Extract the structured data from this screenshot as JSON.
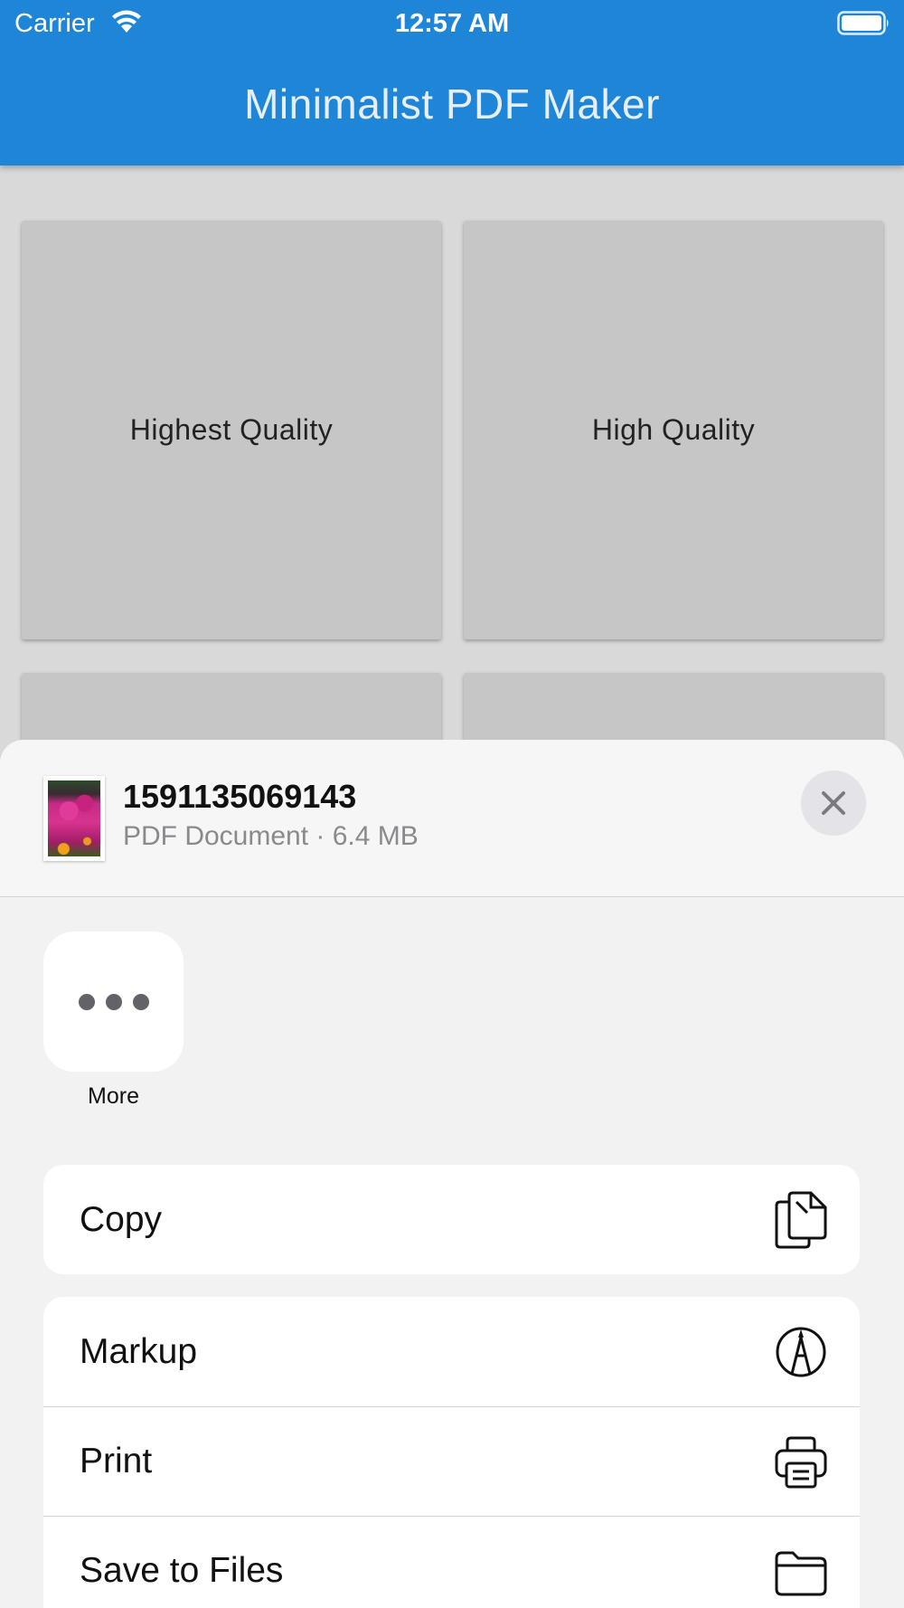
{
  "status_bar": {
    "carrier": "Carrier",
    "time": "12:57 AM",
    "icons": [
      "wifi-icon",
      "battery-icon"
    ]
  },
  "app_bar": {
    "title": "Minimalist PDF Maker",
    "color": "#1f85d6"
  },
  "tiles": [
    {
      "label": "Highest Quality"
    },
    {
      "label": "High Quality"
    },
    {
      "label": ""
    },
    {
      "label": ""
    }
  ],
  "share_sheet": {
    "document": {
      "name": "1591135069143",
      "meta": "PDF Document · 6.4 MB"
    },
    "close_icon": "close-icon",
    "apps": [
      {
        "label": "More",
        "icon": "ellipsis-icon"
      }
    ],
    "actions_group_1": [
      {
        "label": "Copy",
        "icon": "copy-icon"
      }
    ],
    "actions_group_2": [
      {
        "label": "Markup",
        "icon": "markup-icon"
      },
      {
        "label": "Print",
        "icon": "print-icon"
      },
      {
        "label": "Save to Files",
        "icon": "folder-icon"
      }
    ]
  }
}
